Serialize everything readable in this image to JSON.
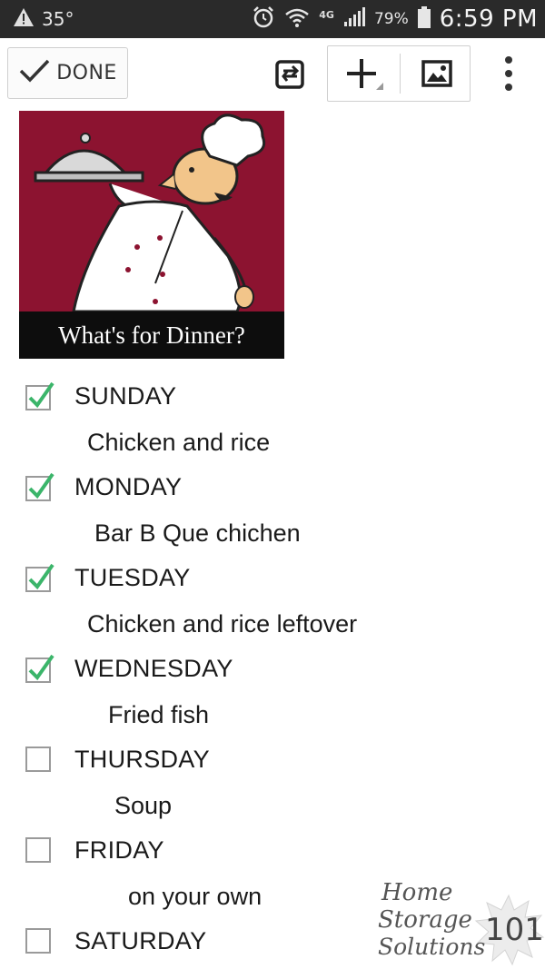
{
  "status_bar": {
    "temperature": "35°",
    "network": "4G",
    "battery": "79%",
    "time": "6:59 PM"
  },
  "toolbar": {
    "done_label": "DONE"
  },
  "banner": {
    "caption": "What's for Dinner?"
  },
  "checklist": [
    {
      "day": "SUNDAY",
      "meal": "Chicken and rice",
      "checked": true
    },
    {
      "day": "MONDAY",
      "meal": "Bar B Que chichen",
      "checked": true
    },
    {
      "day": "TUESDAY",
      "meal": "Chicken and rice leftover",
      "checked": true
    },
    {
      "day": "WEDNESDAY",
      "meal": "Fried fish",
      "checked": true
    },
    {
      "day": "THURSDAY",
      "meal": "Soup",
      "checked": false
    },
    {
      "day": "FRIDAY",
      "meal": "on your own",
      "checked": false
    },
    {
      "day": "SATURDAY",
      "checked": false
    }
  ],
  "watermark": {
    "line1": "Home",
    "line2": "Storage",
    "line3": "Solutions",
    "number": "101"
  },
  "colors": {
    "check": "#3bb56a",
    "banner_bg": "#8c1330",
    "status_bar": "#2a2a2a"
  }
}
